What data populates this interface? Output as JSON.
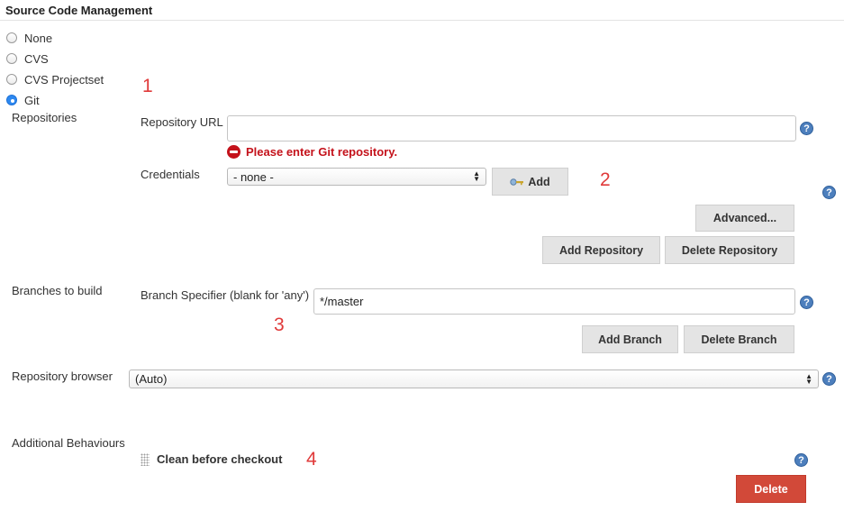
{
  "section": {
    "title": "Source Code Management"
  },
  "scm": {
    "options": [
      {
        "label": "None",
        "selected": false
      },
      {
        "label": "CVS",
        "selected": false
      },
      {
        "label": "CVS Projectset",
        "selected": false
      },
      {
        "label": "Git",
        "selected": true
      }
    ]
  },
  "repositories": {
    "label": "Repositories",
    "url_label": "Repository URL",
    "url_value": "",
    "error": "Please enter Git repository.",
    "credentials_label": "Credentials",
    "credentials_value": "- none -",
    "add_label": "Add",
    "advanced_label": "Advanced...",
    "add_repository_label": "Add Repository",
    "delete_repository_label": "Delete Repository"
  },
  "branches": {
    "label": "Branches to build",
    "specifier_label": "Branch Specifier (blank for 'any')",
    "specifier_value": "*/master",
    "add_branch_label": "Add Branch",
    "delete_branch_label": "Delete Branch"
  },
  "repo_browser": {
    "label": "Repository browser",
    "value": "(Auto)"
  },
  "behaviours": {
    "label": "Additional Behaviours",
    "item_label": "Clean before checkout",
    "delete_label": "Delete"
  },
  "annotations": [
    "1",
    "2",
    "3",
    "4"
  ],
  "help_glyph": "?",
  "icons": {
    "help": "help-icon",
    "error": "error-icon",
    "key": "key-icon",
    "grip": "drag-handle-icon"
  },
  "colors": {
    "error": "#c4121b",
    "radio_selected": "#2d88f0",
    "help": "#4d7fbd",
    "delete_button": "#d24939",
    "annotation": "#e03a3a"
  }
}
